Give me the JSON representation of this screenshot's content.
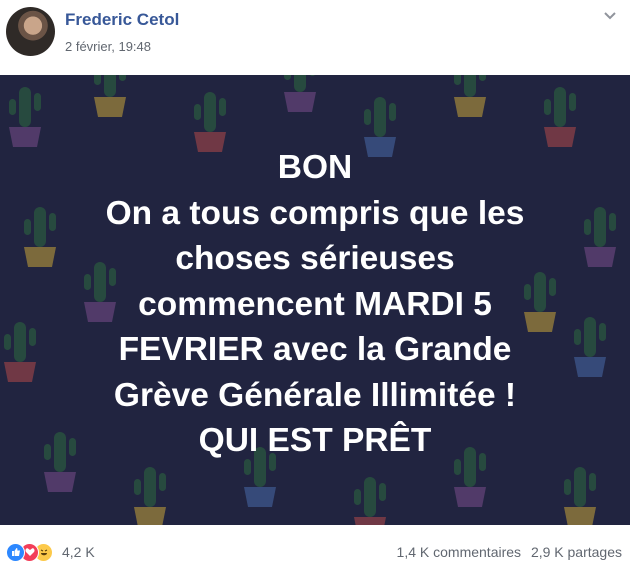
{
  "post": {
    "author": "Frederic Cetol",
    "timestamp": "2 février, 19:48"
  },
  "banner": {
    "background_color": "#212440",
    "text_color": "#ffffff",
    "lines": [
      "BON",
      "On a tous compris que les",
      "choses sérieuses",
      "commencent MARDI 5",
      "FEVRIER avec la Grande",
      "Grève Générale Illimitée !",
      "QUI EST PRÊT"
    ]
  },
  "footer": {
    "reaction_icons": [
      "like-icon",
      "love-icon",
      "haha-icon"
    ],
    "reaction_count": "4,2 K",
    "comments": "1,4 K commentaires",
    "shares": "2,9 K partages"
  },
  "colors": {
    "author_link": "#385898",
    "meta_text": "#616770"
  }
}
